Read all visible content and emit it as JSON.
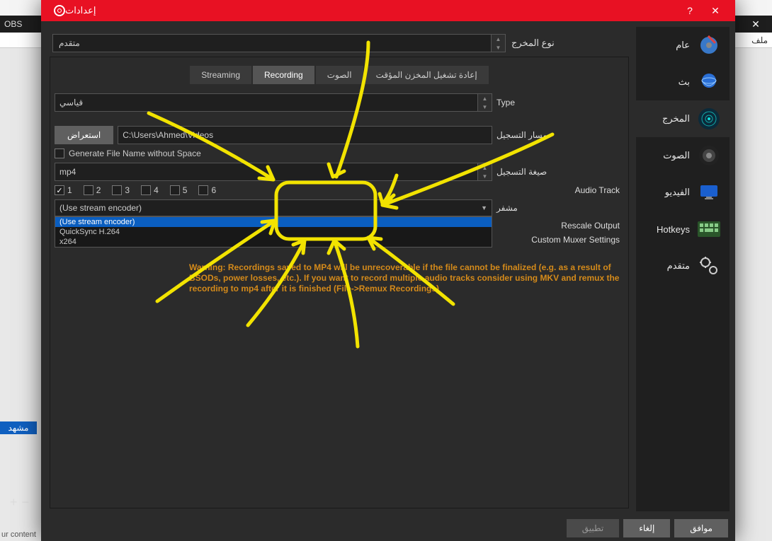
{
  "background": {
    "app_title_prefix": "OBS",
    "menu_file": "ملف",
    "scene_label": "مشهد",
    "close_glyph": "✕",
    "footer_text": "ur content",
    "plus": "+",
    "minus": "−"
  },
  "titlebar": {
    "title": "إعدادات",
    "help": "?",
    "close": "✕"
  },
  "sidebar": {
    "items": [
      {
        "label": "عام"
      },
      {
        "label": "بث"
      },
      {
        "label": "المخرج"
      },
      {
        "label": "الصوت"
      },
      {
        "label": "الفيديو"
      },
      {
        "label": "Hotkeys"
      },
      {
        "label": "متقدم"
      }
    ]
  },
  "output_mode": {
    "label": "نوع المخرج",
    "value": "متقدم"
  },
  "tabs": {
    "streaming": "Streaming",
    "recording": "Recording",
    "audio": "الصوت",
    "replay": "إعادة تشغيل المخزن المؤقت"
  },
  "fields": {
    "type_label": "Type",
    "type_value": "قياسي",
    "path_label": "مسار التسجيل",
    "path_value": "C:\\Users\\Ahmed\\Videos",
    "browse_label": "استعراض",
    "no_space_label": "Generate File Name without Space",
    "format_label": "صيغة التسجيل",
    "format_value": "mp4",
    "audio_track_label": "Audio Track",
    "tracks": [
      "1",
      "2",
      "3",
      "4",
      "5",
      "6"
    ],
    "encoder_label": "مشفر",
    "encoder_value": "(Use stream encoder)",
    "encoder_options": [
      "(Use stream encoder)",
      "QuickSync H.264",
      "x264"
    ],
    "rescale_label": "Rescale Output",
    "muxer_label": "Custom Muxer Settings"
  },
  "warning": "Warning: Recordings saved to MP4 will be unrecoverable if the file cannot be finalized (e.g. as a result of BSODs, power losses, etc.). If you want to record multiple audio tracks consider using MKV and remux the recording to mp4 after it is finished (File->Remux Recordings)",
  "footer": {
    "ok": "موافق",
    "cancel": "إلغاء",
    "apply": "تطبيق"
  }
}
